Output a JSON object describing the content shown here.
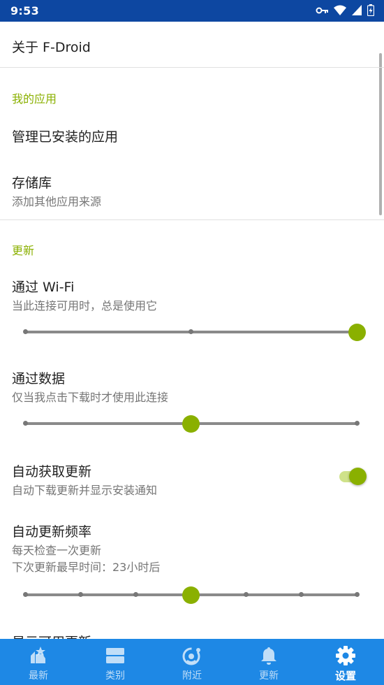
{
  "status_bar": {
    "time": "9:53"
  },
  "about": {
    "label": "关于 F-Droid"
  },
  "my_apps": {
    "header": "我的应用",
    "manage_installed": "管理已安装的应用",
    "repos": {
      "title": "存储库",
      "summary": "添加其他应用来源"
    }
  },
  "updates": {
    "header": "更新",
    "wifi": {
      "title": "通过 Wi-Fi",
      "summary": "当此连接可用时，总是使用它",
      "slider_value": 2,
      "slider_max": 2
    },
    "data": {
      "title": "通过数据",
      "summary": "仅当我点击下载时才使用此连接",
      "slider_value": 1,
      "slider_max": 2
    },
    "auto_fetch": {
      "title": "自动获取更新",
      "summary": "自动下载更新并显示安装通知",
      "enabled": true
    },
    "frequency": {
      "title": "自动更新频率",
      "summary": "每天检查一次更新",
      "next": "下次更新最早时间：23小时后",
      "slider_value": 3,
      "slider_max": 6
    },
    "show_available": {
      "title": "显示可用更新"
    }
  },
  "bottom_nav": [
    {
      "label": "最新",
      "icon": "whats-new-icon",
      "active": false
    },
    {
      "label": "类别",
      "icon": "categories-icon",
      "active": false
    },
    {
      "label": "附近",
      "icon": "nearby-icon",
      "active": false
    },
    {
      "label": "更新",
      "icon": "updates-bell-icon",
      "active": false
    },
    {
      "label": "设置",
      "icon": "settings-gear-icon",
      "active": true
    }
  ],
  "colors": {
    "accent": "#8ab000",
    "status_bar": "#0d47a1",
    "bottom_nav": "#1e88e5"
  }
}
